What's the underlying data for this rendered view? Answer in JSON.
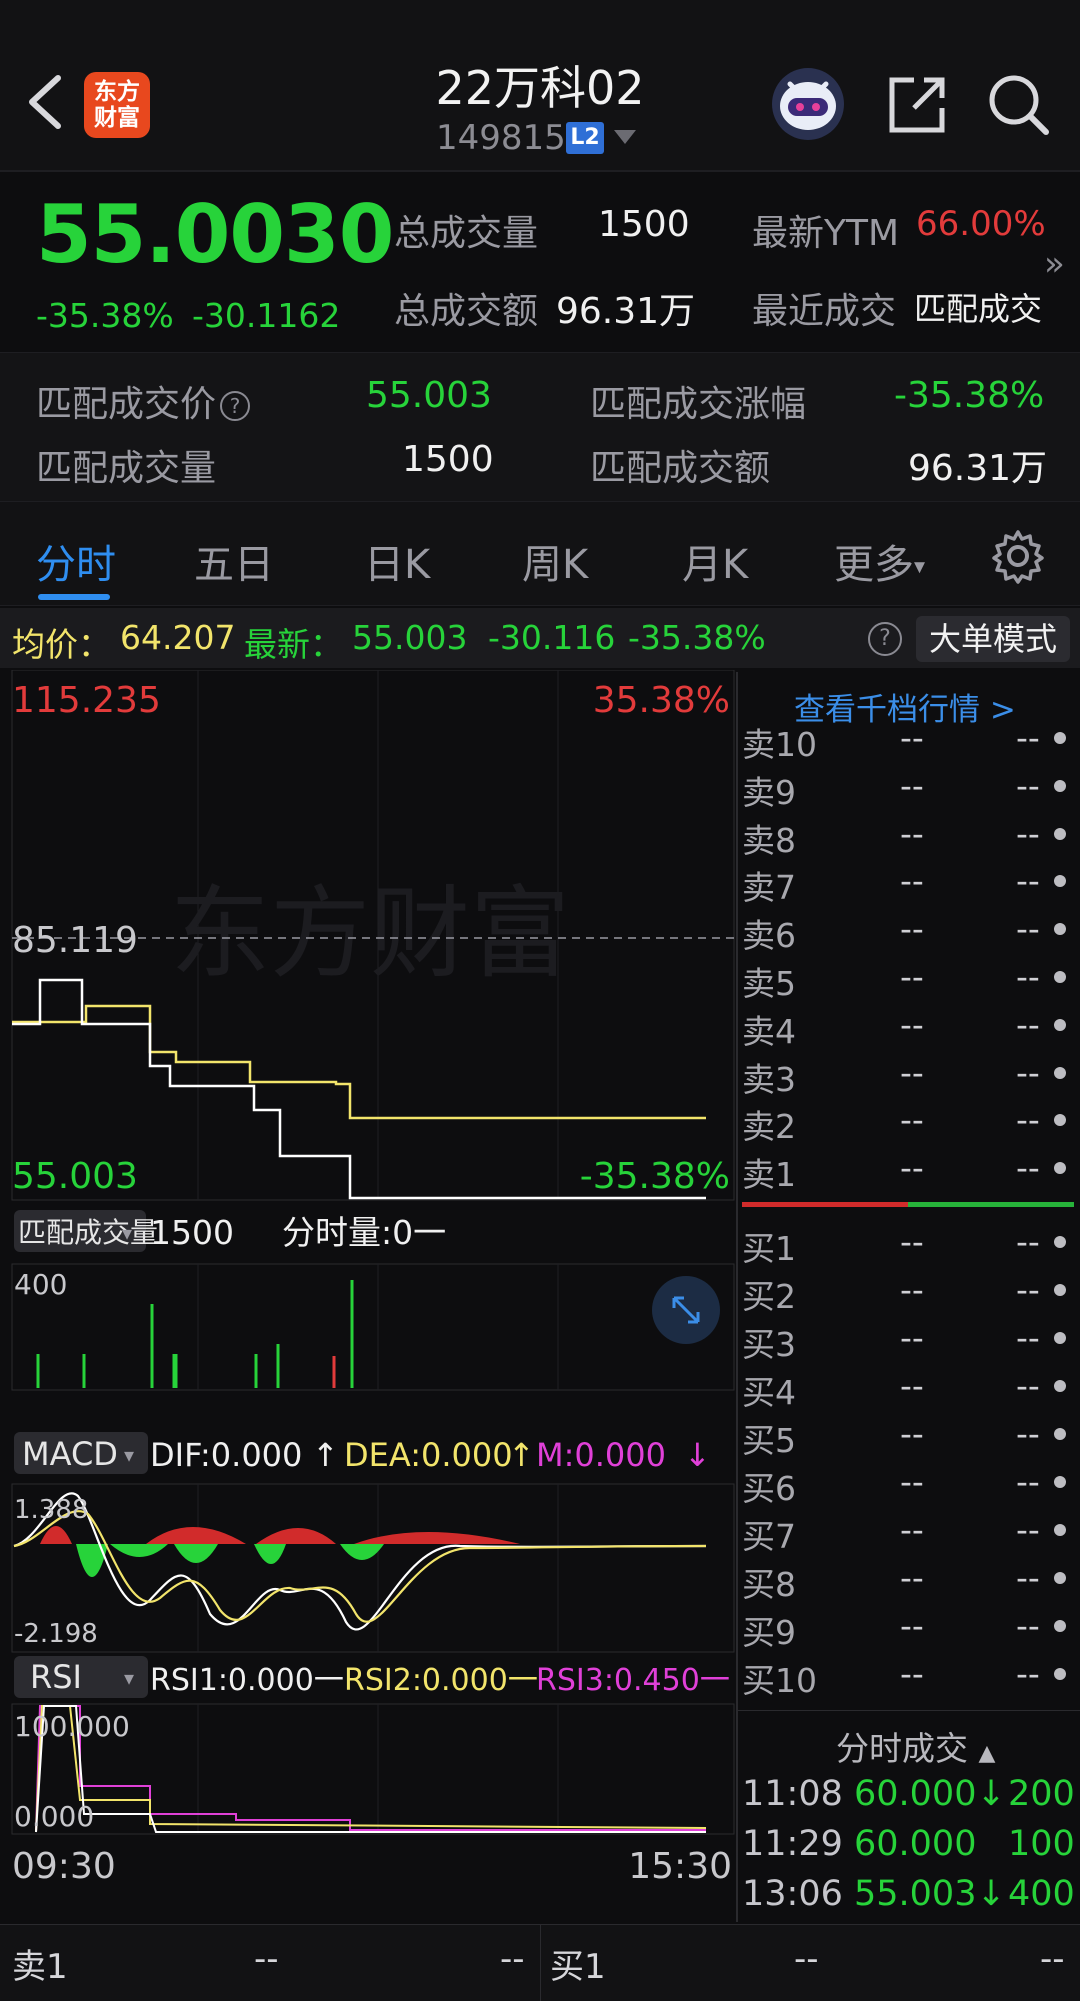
{
  "header": {
    "back_icon": "chevron-left-icon",
    "logo_text_line1": "东方",
    "logo_text_line2": "财富",
    "title": "22万科02",
    "code": "149815",
    "level_badge": "L2",
    "robot_icon": "robot-assistant-icon",
    "share_icon": "share-icon",
    "search_icon": "search-icon"
  },
  "quote": {
    "price": "55.0030",
    "change_pct": "-35.38%",
    "change_abs": "-30.1162",
    "total_volume_label": "总成交量",
    "total_volume": "1500",
    "latest_ytm_label": "最新YTM",
    "latest_ytm": "66.00%",
    "total_amount_label": "总成交额",
    "total_amount": "96.31万",
    "recent_deal_label": "最近成交",
    "recent_deal": "匹配成交",
    "more_chevron": "»"
  },
  "match": {
    "price_label": "匹配成交价",
    "price": "55.003",
    "change_label": "匹配成交涨幅",
    "change": "-35.38%",
    "volume_label": "匹配成交量",
    "volume": "1500",
    "amount_label": "匹配成交额",
    "amount": "96.31万"
  },
  "tabs": [
    "分时",
    "五日",
    "日K",
    "周K",
    "月K",
    "更多"
  ],
  "active_tab": "分时",
  "avg_line": {
    "avg_label": "均价：",
    "avg_value": "64.207",
    "latest_label": "最新：",
    "latest_value": "55.003",
    "latest_change": "-30.116",
    "latest_pct": "-35.38%",
    "big_order_mode": "大单模式"
  },
  "chart": {
    "high_price": "115.235",
    "high_pct": "35.38%",
    "prev_close": "85.119",
    "low_price": "55.003",
    "low_pct": "-35.38%",
    "watermark": "东方财富",
    "time_start": "09:30",
    "time_end": "15:30",
    "price_path_hint": "white=price, yellow=avg",
    "volume_selector": "匹配成交量",
    "volume_value": "1500",
    "minute_volume": "分时量:0一",
    "volume_axis_top": "400",
    "macd_selector": "MACD",
    "dif": "DIF:0.000",
    "dea": "DEA:0.000",
    "m": "M:0.000",
    "macd_top": "1.388",
    "macd_bottom": "-2.198",
    "rsi_selector": "RSI",
    "rsi1": "RSI1:0.000一",
    "rsi2": "RSI2:0.000一",
    "rsi3": "RSI3:0.450一",
    "rsi_top": "100.000",
    "rsi_bottom": "0.000",
    "up_arrow": "↑",
    "down_arrow": "↓"
  },
  "chart_data": {
    "type": "line",
    "x": [
      "09:30",
      "15:30"
    ],
    "ylim": [
      55.003,
      115.235
    ],
    "series": [],
    "xlabel": "",
    "ylabel": ""
  },
  "orderbook": {
    "link": "查看千档行情 >",
    "sells": [
      "卖10",
      "卖9",
      "卖8",
      "卖7",
      "卖6",
      "卖5",
      "卖4",
      "卖3",
      "卖2",
      "卖1"
    ],
    "buys": [
      "买1",
      "买2",
      "买3",
      "买4",
      "买5",
      "买6",
      "买7",
      "买8",
      "买9",
      "买10"
    ],
    "empty": "--"
  },
  "deals": {
    "title": "分时成交",
    "rows": [
      {
        "time": "11:08",
        "price": "60.000↓",
        "vol": "200"
      },
      {
        "time": "11:29",
        "price": "60.000",
        "vol": "100"
      },
      {
        "time": "13:06",
        "price": "55.003↓",
        "vol": "400"
      }
    ]
  },
  "bottom": {
    "sell_label": "卖1",
    "sell_price": "--",
    "sell_vol": "--",
    "buy_label": "买1",
    "buy_price": "--",
    "buy_vol": "--"
  },
  "colors": {
    "up": "#e23b3b",
    "down": "#27d33a",
    "accent": "#2f8ef0",
    "avg": "#f2e46b",
    "magenta": "#e040d8"
  }
}
